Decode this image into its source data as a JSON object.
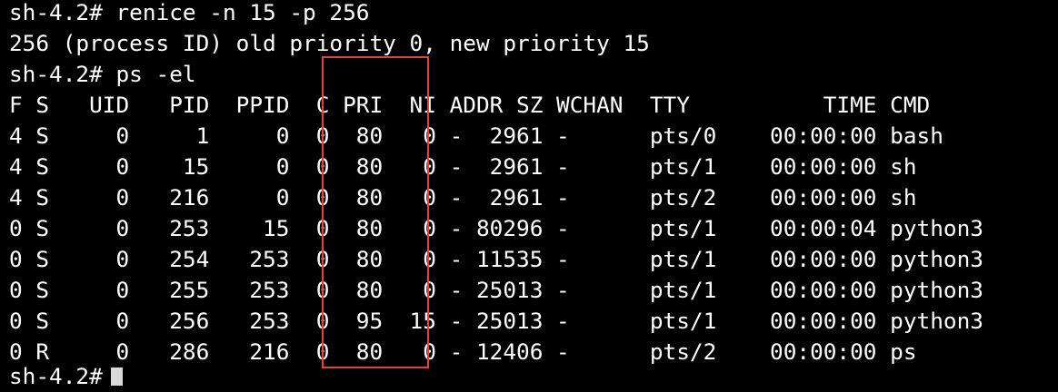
{
  "terminal": {
    "lines": [
      "sh-4.2# renice -n 15 -p 256",
      "256 (process ID) old priority 0, new priority 15",
      "sh-4.2# ps -el",
      "F S   UID   PID  PPID  C PRI  NI ADDR SZ WCHAN  TTY          TIME CMD",
      "4 S     0     1     0  0  80   0 -  2961 -      pts/0    00:00:00 bash",
      "4 S     0    15     0  0  80   0 -  2961 -      pts/1    00:00:00 sh",
      "4 S     0   216     0  0  80   0 -  2961 -      pts/2    00:00:00 sh",
      "0 S     0   253    15  0  80   0 - 80296 -      pts/1    00:00:04 python3",
      "0 S     0   254   253  0  80   0 - 11535 -      pts/1    00:00:00 python3",
      "0 S     0   255   253  0  80   0 - 25013 -      pts/1    00:00:00 python3",
      "0 S     0   256   253  0  95  15 - 25013 -      pts/1    00:00:00 python3",
      "0 R     0   286   216  0  80   0 - 12406 -      pts/2    00:00:00 ps",
      "sh-4.2# "
    ],
    "text_color": "#ffffff",
    "background_color": "#000000",
    "highlight_color": "#e0443a"
  }
}
